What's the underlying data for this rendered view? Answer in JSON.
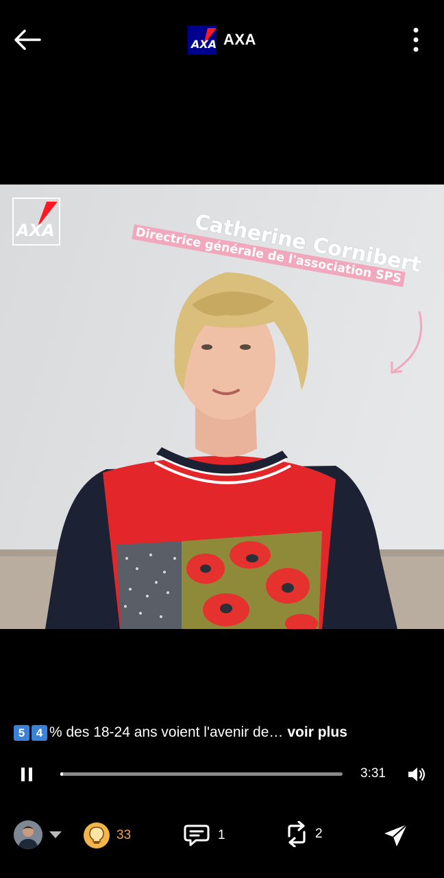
{
  "header": {
    "back_icon": "arrow-left-icon",
    "brand_name": "AXA",
    "brand_logo_text": "AXA",
    "more_icon": "more-vertical-icon"
  },
  "video": {
    "overlay_logo_text": "AXA",
    "person_name": "Catherine Cornibert",
    "person_title": "Directrice générale de l'association SPS",
    "colors": {
      "accent_pink": "#f2a8bc",
      "axa_blue": "#00008f",
      "axa_red": "#ff1721"
    }
  },
  "caption": {
    "keycap_1": "5",
    "keycap_2": "4",
    "text": "% des 18-24 ans voient l'avenir de…",
    "see_more": "voir plus"
  },
  "player": {
    "pause_icon": "pause-icon",
    "progress": 0.0,
    "time": "3:31",
    "volume_icon": "volume-icon"
  },
  "actions": {
    "reactions_count": "33",
    "comments_count": "1",
    "reposts_count": "2",
    "send_icon": "send-icon"
  }
}
